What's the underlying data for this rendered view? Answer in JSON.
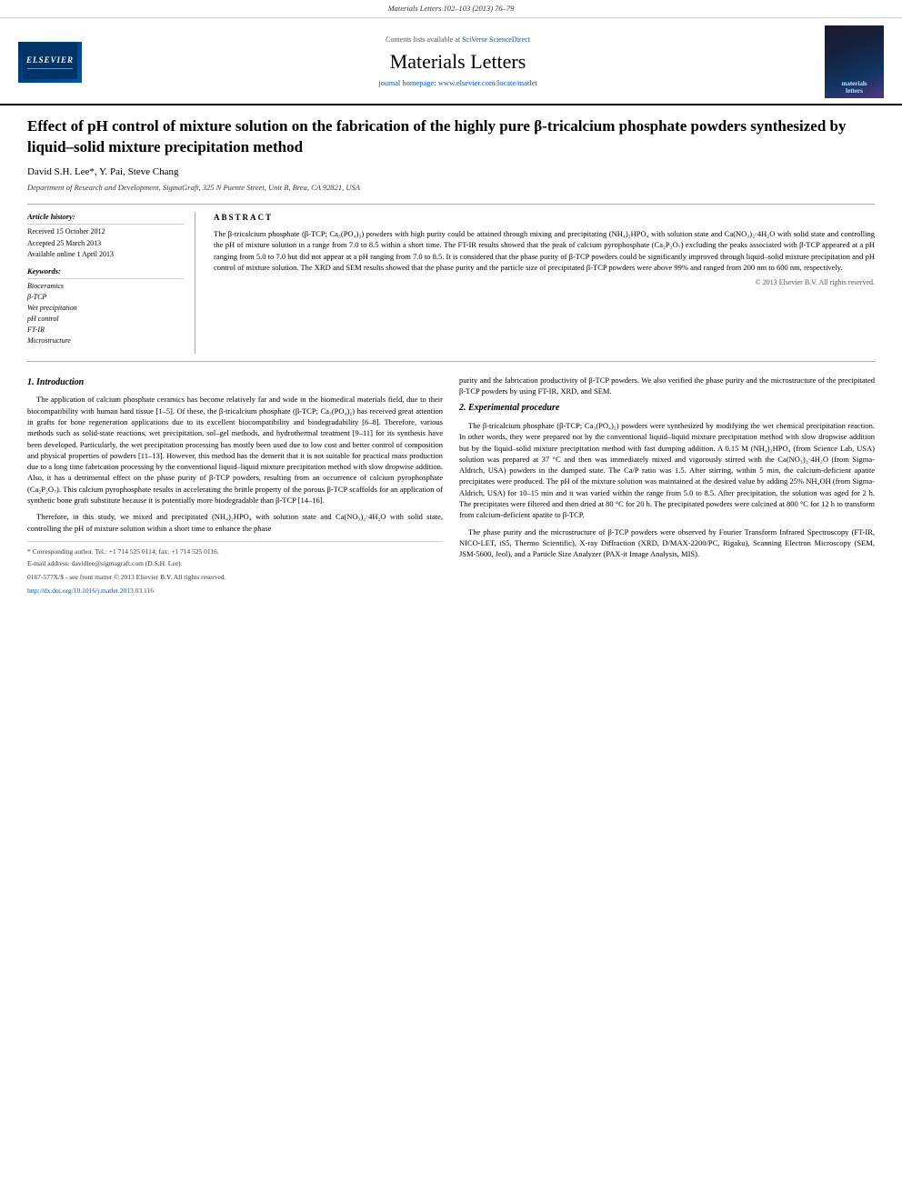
{
  "topBar": {
    "text": "Materials Letters 102–103 (2013) 76–79"
  },
  "journalHeader": {
    "elsevierLabel": "ELSEVIER",
    "sciverseText": "Contents lists available at",
    "sciverseLink": "SciVerse ScienceDirect",
    "journalTitle": "Materials Letters",
    "homepageLabel": "journal homepage:",
    "homepageUrl": "www.elsevier.com/locate/matlet",
    "thumbLabel": "materials\nletters"
  },
  "article": {
    "title": "Effect of pH control of mixture solution on the fabrication of the highly pure β-tricalcium phosphate powders synthesized by liquid–solid mixture precipitation method",
    "authors": "David S.H. Lee*, Y. Pai, Steve Chang",
    "affiliation": "Department of Research and Development, SigmaGraft, 325 N Puente Street, Unit B, Brea, CA 92821, USA",
    "articleInfo": {
      "heading": "Article history:",
      "received": "Received 15 October 2012",
      "accepted": "Accepted 25 March 2013",
      "availableOnline": "Available online 1 April 2013",
      "keywordsHeading": "Keywords:",
      "keywords": [
        "Bioceramics",
        "β-TCP",
        "Wet precipitation",
        "pH control",
        "FT-IR",
        "Microstructure"
      ]
    },
    "abstractHeading": "ABSTRACT",
    "abstractText": "The β-tricalcium phosphate (β-TCP; Ca₃(PO₄)₂) powders with high purity could be attained through mixing and precipitating (NH₄)₂HPO₄ with solution state and Ca(NO₃)₂·4H₂O with solid state and controlling the pH of mixture solution in a range from 7.0 to 8.5 within a short time. The FT-IR results showed that the peak of calcium pyrophosphate (Ca₂P₂O₇) excluding the peaks associated with β-TCP appeared at a pH ranging from 5.0 to 7.0 but did not appear at a pH ranging from 7.0 to 8.5. It is considered that the phase purity of β-TCP powders could be significantly improved through liquid–solid mixture precipitation and pH control of mixture solution. The XRD and SEM results showed that the phase purity and the particle size of precipitated β-TCP powders were above 99% and ranged from 200 nm to 600 nm, respectively.",
    "copyright": "© 2013 Elsevier B.V. All rights reserved.",
    "sections": {
      "introduction": {
        "heading": "1.   Introduction",
        "paragraphs": [
          "The application of calcium phosphate ceramics has become relatively far and wide in the biomedical materials field, due to their biocompatibility with human hard tissue [1–5]. Of these, the β-tricalcium phosphate (β-TCP; Ca₃(PO₄)₂) has received great attention in grafts for bone regeneration applications due to its excellent biocompatibility and biodegradability [6–8]. Therefore, various methods such as solid-state reactions, wet precipitation, sol–gel methods, and hydrothermal treatment [9–11] for its synthesis have been developed. Particularly, the wet precipitation processing has mostly been used due to low cost and better control of composition and physical properties of powders [11–13]. However, this method has the demerit that it is not suitable for practical mass production due to a long time fabrication processing by the conventional liquid–liquid mixture precipitation method with slow dropwise addition. Also, it has a detrimental effect on the phase purity of β-TCP powders, resulting from an occurrence of calcium pyrophosphate (Ca₂P₂O₇). This calcium pyrophosphate results in accelerating the brittle property of the porous β-TCP scaffolds for an application of synthetic bone graft substitute because it is potentially more biodegradable than β-TCP [14–16].",
          "Therefore, in this study, we mixed and precipitated (NH₄)₂HPO₄ with solution state and Ca(NO₃)₂·4H₂O with solid state, controlling the pH of mixture solution within a short time to enhance the phase"
        ]
      },
      "rightCol": {
        "introEnd": "purity and the fabrication productivity of β-TCP powders. We also verified the phase purity and the microstructure of the precipitated β-TCP powders by using FT-IR, XRD, and SEM.",
        "expHeading": "2.   Experimental procedure",
        "expParagraphs": [
          "The β-tricalcium phosphate (β-TCP; Ca₃(PO₄)₂) powders were synthesized by modifying the wet chemical precipitation reaction. In other words, they were prepared not by the conventional liquid–liquid mixture precipitation method with slow dropwise addition but by the liquid–solid mixture precipitation method with fast dumping addition. A 0.15 M (NH₄)₂HPO₄ (from Science Lab, USA) solution was prepared at 37 °C and then was immediately mixed and vigorously stirred with the Ca(NO₃)₂·4H₂O (from Sigma-Aldrich, USA) powders in the dumped state. The Ca/P ratio was 1.5. After stirring, within 5 min, the calcium-deficient apatite precipitates were produced. The pH of the mixture solution was maintained at the desired value by adding 25% NH₄OH (from Sigma-Aldrich, USA) for 10–15 min and it was varied within the range from 5.0 to 8.5. After precipitation, the solution was aged for 2 h. The precipitates were filtered and then dried at 80 °C for 20 h. The precipitated powders were calcined at 800 °C for 12 h to transform from calcium-deficient apatite to β-TCP.",
          "The phase purity and the microstructure of β-TCP powders were observed by Fourier Transform Infrared Spectroscopy (FT-IR, NICO-LET, iS5, Thermo Scientific), X-ray Diffraction (XRD, D/MAX-2200/PC, Rigaku), Scanning Electron Microscopy (SEM, JSM-5600, Jeol), and a Particle Size Analyzer (PAX-it Image Analysis, MIS)."
        ]
      }
    },
    "footnotes": {
      "corresponding": "* Corresponding author. Tel.: +1 714 525 0114; fax: +1 714 525 0116.",
      "email": "E-mail address: davidlee@sigmagraft.com (D.S.H. Lee).",
      "issn": "0167-577X/$ - see front matter © 2013 Elsevier B.V. All rights reserved.",
      "doi": "http://dx.doi.org/10.1016/j.matlet.2013.03.116"
    }
  }
}
